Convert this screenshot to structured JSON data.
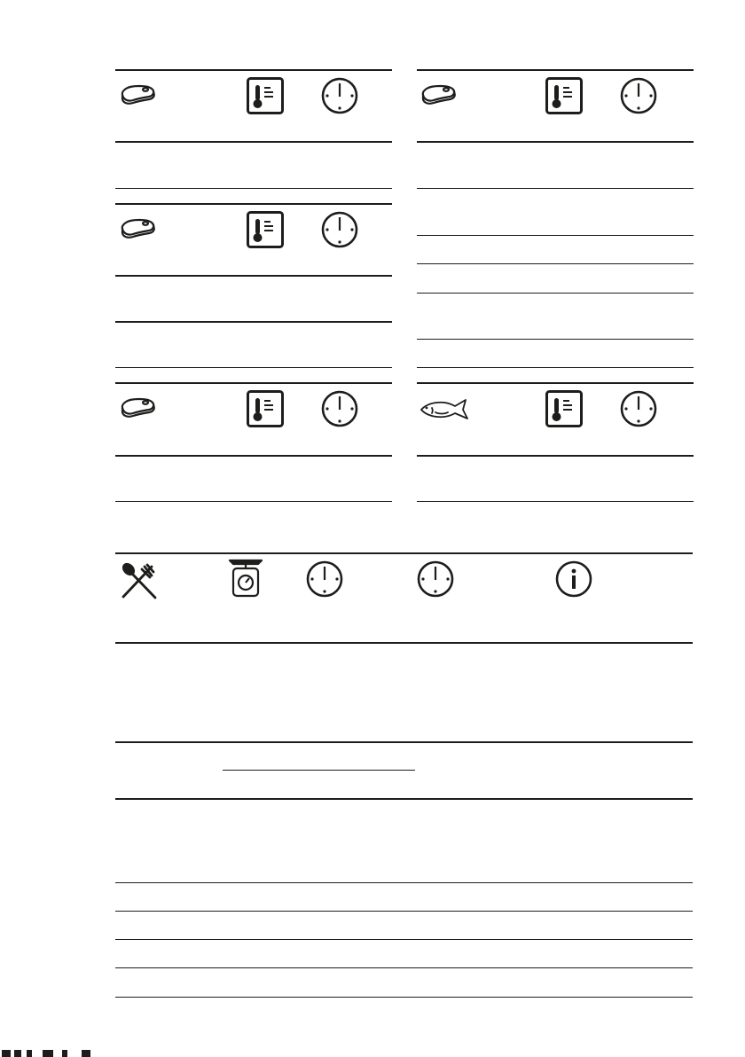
{
  "tables": {
    "meat_left_1": {
      "header_icons": [
        "steak-icon",
        "thermometer-icon",
        "clock-icon"
      ],
      "rows": [
        ""
      ]
    },
    "meat_left_2": {
      "header_icons": [
        "steak-icon",
        "thermometer-icon",
        "clock-icon"
      ],
      "rows": [
        "",
        ""
      ]
    },
    "meat_left_3": {
      "header_icons": [
        "steak-icon",
        "thermometer-icon",
        "clock-icon"
      ],
      "rows": [
        ""
      ]
    },
    "meat_right": {
      "header_icons": [
        "steak-icon",
        "thermometer-icon",
        "clock-icon"
      ],
      "rows": [
        "",
        "",
        "",
        "",
        "",
        ""
      ]
    },
    "fish_right": {
      "header_icons": [
        "fish-icon",
        "thermometer-icon",
        "clock-icon"
      ],
      "rows": [
        ""
      ]
    },
    "defrost": {
      "header_icons": [
        "cutlery-icon",
        "kitchen-scale-icon",
        "clock-icon",
        "clock-icon",
        "info-icon"
      ],
      "rows": [
        "",
        "",
        "",
        "",
        "",
        "",
        ""
      ]
    }
  },
  "colors": {
    "ink": "#1d1d1b",
    "background": "#ffffff"
  }
}
